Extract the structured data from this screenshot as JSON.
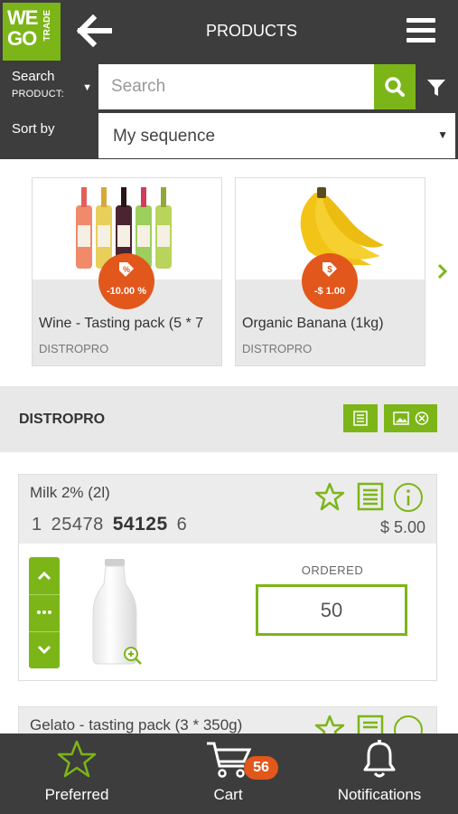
{
  "header": {
    "logo": {
      "line1": "WE",
      "line2": "GO",
      "line3": "TRADE"
    },
    "title": "PRODUCTS"
  },
  "search": {
    "scope_label": "Search",
    "scope_value": "PRODUCT:",
    "placeholder": "Search",
    "value": ""
  },
  "sort": {
    "label": "Sort by",
    "value": "My sequence"
  },
  "promotions": [
    {
      "name": "Wine - Tasting pack (5 * 7",
      "name_faded": "5",
      "supplier": "DISTROPRO",
      "discount": "-10.00 %"
    },
    {
      "name": "Organic Banana (1kg)",
      "supplier": "DISTROPRO",
      "discount": "-$ 1.00"
    }
  ],
  "supplier_section": {
    "name": "DISTROPRO"
  },
  "products": [
    {
      "name": "Milk 2% (2l)",
      "codes": [
        "1",
        "25478",
        "54125",
        "6"
      ],
      "price": "$ 5.00",
      "ordered_label": "ORDERED",
      "ordered_value": "50"
    },
    {
      "name": "Gelato - tasting pack (3 * 350g)"
    }
  ],
  "bottom_nav": {
    "preferred": "Preferred",
    "cart": "Cart",
    "cart_count": "56",
    "notifications": "Notifications"
  },
  "colors": {
    "brand_green": "#7cb518",
    "dark_bar": "#3d3d3d",
    "accent_orange": "#e2571b"
  },
  "icons": [
    "back-arrow-icon",
    "hamburger-menu-icon",
    "search-icon",
    "filter-icon",
    "tag-percent-icon",
    "tag-dollar-icon",
    "chevron-right-icon",
    "list-view-icon",
    "image-view-icon",
    "star-icon",
    "info-icon",
    "chevron-up-icon",
    "more-icon",
    "chevron-down-icon",
    "zoom-in-icon",
    "cart-icon",
    "bell-icon"
  ]
}
